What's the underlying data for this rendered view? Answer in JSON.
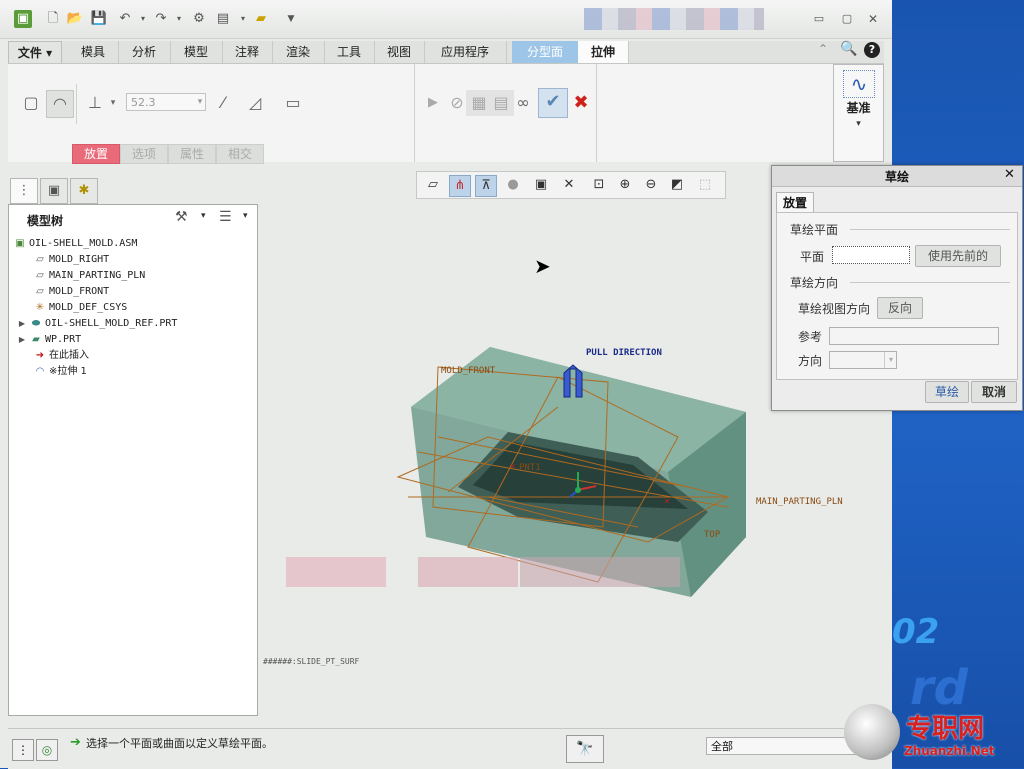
{
  "toolbar": {
    "icons": [
      "new-icon",
      "open-icon",
      "save-icon",
      "undo-icon",
      "redo-icon",
      "regenerate-icon",
      "windows-icon",
      "folder-icon",
      "customize-icon"
    ]
  },
  "menu": {
    "tabs": [
      "文件",
      "模具",
      "分析",
      "模型",
      "注释",
      "渲染",
      "工具",
      "视图",
      "应用程序",
      "分型面",
      "拉伸"
    ]
  },
  "ribbon": {
    "depth_value": "52.3",
    "subtabs": [
      "放置",
      "选项",
      "属性",
      "相交"
    ],
    "datum_label": "基准"
  },
  "model_tree": {
    "title": "模型树",
    "items": [
      {
        "label": "OIL-SHELL_MOLD.ASM",
        "icon": "assembly-icon"
      },
      {
        "label": "MOLD_RIGHT",
        "icon": "datum-plane-icon"
      },
      {
        "label": "MAIN_PARTING_PLN",
        "icon": "datum-plane-icon"
      },
      {
        "label": "MOLD_FRONT",
        "icon": "datum-plane-icon"
      },
      {
        "label": "MOLD_DEF_CSYS",
        "icon": "csys-icon"
      },
      {
        "label": "OIL-SHELL_MOLD_REF.PRT",
        "icon": "part-icon"
      },
      {
        "label": "WP.PRT",
        "icon": "workpiece-icon"
      },
      {
        "label": "在此插入",
        "icon": "insert-arrow-icon"
      },
      {
        "label": "※拉伸 1",
        "icon": "extrude-icon"
      }
    ]
  },
  "viewport": {
    "labels": {
      "pull_direction": "PULL DIRECTION",
      "mold_front": "MOLD_FRONT",
      "main_parting": "MAIN_PARTING_PLN",
      "pnt1": "PNT1",
      "top": "TOP",
      "slide": "######:SLIDE_PT_SURF"
    }
  },
  "dialog": {
    "title": "草绘",
    "tab": "放置",
    "section_plane": "草绘平面",
    "plane_label": "平面",
    "use_previous": "使用先前的",
    "section_orientation": "草绘方向",
    "view_dir_label": "草绘视图方向",
    "flip": "反向",
    "reference_label": "参考",
    "orientation_label": "方向",
    "sketch_btn": "草绘",
    "cancel_btn": "取消"
  },
  "status": {
    "message": "选择一个平面或曲面以定义草绘平面。",
    "filter": "全部"
  },
  "watermark": {
    "site": "专职网",
    "url": "Zhuanzhi.Net",
    "big_text": "02"
  },
  "colors": {
    "desktop_blue": "#1a56b8",
    "accent_red": "#e96b7a",
    "accent_blue": "#9cc5e8"
  }
}
